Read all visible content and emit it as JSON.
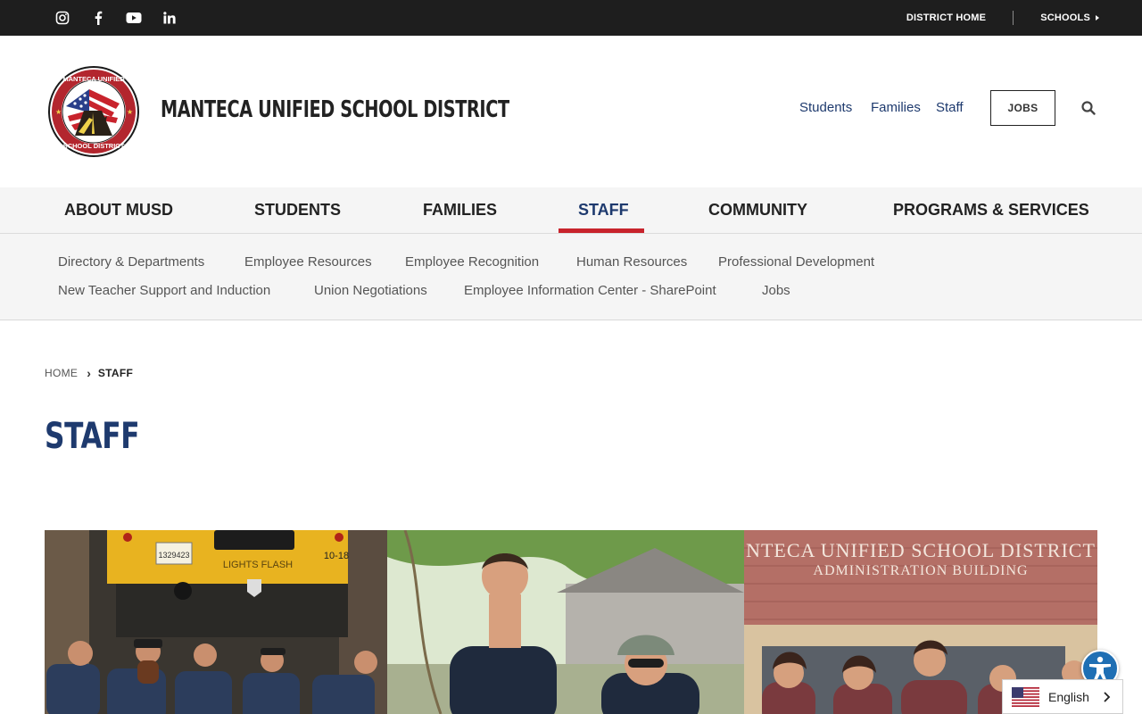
{
  "topbar": {
    "social": [
      {
        "name": "instagram-icon"
      },
      {
        "name": "facebook-icon"
      },
      {
        "name": "youtube-icon"
      },
      {
        "name": "linkedin-icon"
      }
    ],
    "district_home": "DISTRICT HOME",
    "schools": "SCHOOLS"
  },
  "header": {
    "logo_text": {
      "top": "MANTECA UNIFIED",
      "bottom": "SCHOOL DISTRICT"
    },
    "site_name": "MANTECA UNIFIED SCHOOL DISTRICT",
    "audience_links": [
      "Students",
      "Families",
      "Staff"
    ],
    "jobs": "JOBS",
    "search_icon": "search-icon"
  },
  "mainnav": {
    "items": [
      "ABOUT MUSD",
      "STUDENTS",
      "FAMILIES",
      "STAFF",
      "COMMUNITY",
      "PROGRAMS & SERVICES"
    ],
    "active": "STAFF",
    "accent": "#c8232c"
  },
  "subnav": {
    "row1": [
      "Directory & Departments",
      "Employee Resources",
      "Employee Recognition",
      "Human Resources",
      "Professional Development"
    ],
    "row2": [
      "New Teacher Support and Induction",
      "Union Negotiations",
      "Employee Information Center - SharePoint",
      "Jobs"
    ]
  },
  "breadcrumb": {
    "home": "HOME",
    "current": "STAFF"
  },
  "page": {
    "title": "STAFF"
  },
  "banner": {
    "bus_plate": "1329423",
    "bus_sign": "LIGHTS FLASH",
    "bus_number": "10-18",
    "building_sign_1": "NTECA UNIFIED SCHOOL DISTRICT",
    "building_sign_2": "ADMINISTRATION BUILDING"
  },
  "language": {
    "label": "English",
    "flag": "us-flag-icon"
  },
  "colors": {
    "brand_blue": "#1e3a6e",
    "accent_red": "#c8232c",
    "topbar": "#1e1e1e",
    "a11y_blue": "#1f6fb4"
  }
}
